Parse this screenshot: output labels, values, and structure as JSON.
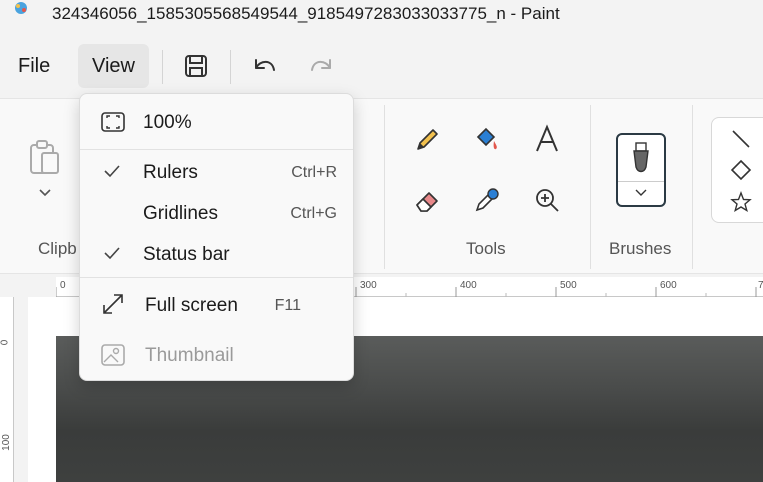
{
  "window": {
    "title": "324346056_1585305568549544_9185497283033033775_n - Paint"
  },
  "menubar": {
    "file_label": "File",
    "view_label": "View"
  },
  "ribbon": {
    "groups": {
      "clipboard": "Clipb",
      "tools": "Tools",
      "brushes": "Brushes"
    }
  },
  "ruler": {
    "h_ticks": [
      "0",
      "300",
      "400",
      "500",
      "600",
      "7"
    ],
    "v_ticks": [
      "0",
      "100"
    ]
  },
  "view_menu": {
    "zoom": {
      "label": "100%"
    },
    "rulers": {
      "label": "Rulers",
      "shortcut": "Ctrl+R",
      "checked": true
    },
    "gridlines": {
      "label": "Gridlines",
      "shortcut": "Ctrl+G",
      "checked": false
    },
    "status_bar": {
      "label": "Status bar",
      "checked": true
    },
    "full_screen": {
      "label": "Full screen",
      "shortcut": "F11"
    },
    "thumbnail": {
      "label": "Thumbnail",
      "disabled": true
    }
  },
  "colors": {
    "accent": "#2b3a44",
    "pencil": "#d4a24c",
    "eraser": "#e8888a",
    "fill": "#2a7fd4",
    "picker": "#2a7fd4"
  }
}
